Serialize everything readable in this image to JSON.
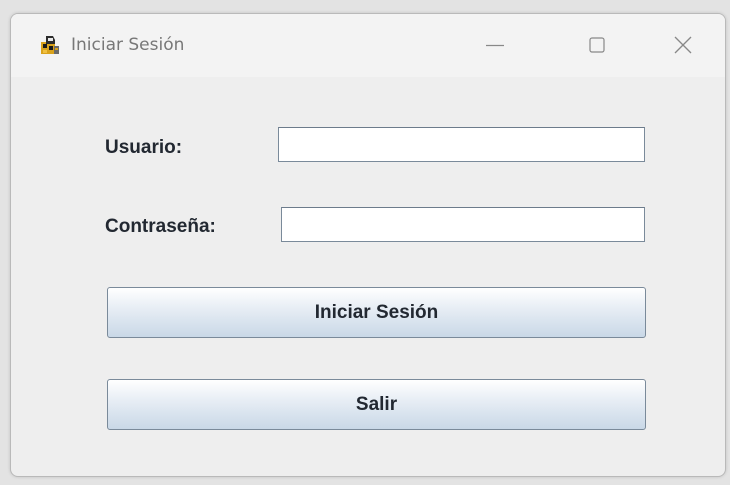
{
  "window": {
    "title": "Iniciar Sesión",
    "icon": "java-duke-icon",
    "controls": {
      "minimize": "minimize-icon",
      "maximize": "maximize-icon",
      "close": "close-icon"
    }
  },
  "form": {
    "user_label": "Usuario:",
    "user_value": "",
    "password_label": "Contraseña:",
    "password_value": ""
  },
  "buttons": {
    "login_label": "Iniciar Sesión",
    "exit_label": "Salir"
  },
  "colors": {
    "window_bg": "#eeeeee",
    "titlebar_bg": "#f3f3f3",
    "label_text": "#222831",
    "button_gradient_top": "#ffffff",
    "button_gradient_bottom": "#c9d8e7",
    "field_border": "#7a8a9a"
  }
}
